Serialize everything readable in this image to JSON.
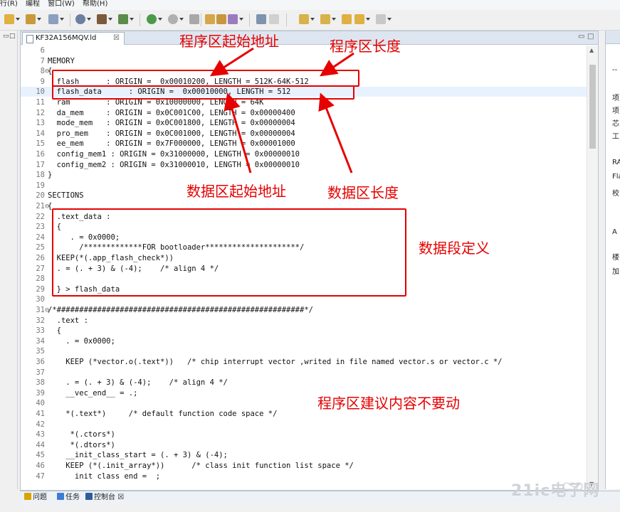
{
  "menubar": {
    "items": [
      "行(R)",
      "编程",
      "窗口(W)",
      "帮助(H)"
    ]
  },
  "toolbar": {
    "buttons": [
      "new-icon",
      "save-icon",
      "copy-icon",
      "build-icon",
      "debug-icon",
      "hammer-icon",
      "tools-icon",
      "bug-icon",
      "run-icon",
      "stop-icon",
      "open-folder-icon",
      "open-file-icon",
      "wand-icon",
      "toggle-icon",
      "pilcrow-icon",
      "next-annotation-icon",
      "prev-annotation-icon",
      "back-icon",
      "forward-icon"
    ]
  },
  "editor": {
    "tab": {
      "label": "KF32A156MQV.ld",
      "close": "☒"
    },
    "tab_controls": {
      "minimize": "▭",
      "maximize": "□"
    },
    "lines": [
      {
        "n": "6",
        "f": "",
        "t": ""
      },
      {
        "n": "7",
        "f": "",
        "t": "MEMORY"
      },
      {
        "n": "8",
        "f": "⊖",
        "t": "{"
      },
      {
        "n": "9",
        "f": "",
        "t": "  flash      : ORIGIN =  0x00010200, LENGTH = 512K-64K-512"
      },
      {
        "n": "10",
        "f": "",
        "t": "  flash_data      : ORIGIN =  0x00010000, LENGTH = 512"
      },
      {
        "n": "11",
        "f": "",
        "t": "  ram        : ORIGIN = 0x10000000, LENGTH = 64K"
      },
      {
        "n": "12",
        "f": "",
        "t": "  da_mem     : ORIGIN = 0x0C001C00, LENGTH = 0x00000400"
      },
      {
        "n": "13",
        "f": "",
        "t": "  mode_mem   : ORIGIN = 0x0C001800, LENGTH = 0x00000004"
      },
      {
        "n": "14",
        "f": "",
        "t": "  pro_mem    : ORIGIN = 0x0C001000, LENGTH = 0x00000004"
      },
      {
        "n": "15",
        "f": "",
        "t": "  ee_mem     : ORIGIN = 0x7F000000, LENGTH = 0x00001000"
      },
      {
        "n": "16",
        "f": "",
        "t": "  config_mem1 : ORIGIN = 0x31000000, LENGTH = 0x00000010"
      },
      {
        "n": "17",
        "f": "",
        "t": "  config_mem2 : ORIGIN = 0x31000010, LENGTH = 0x00000010"
      },
      {
        "n": "18",
        "f": "",
        "t": "}"
      },
      {
        "n": "19",
        "f": "",
        "t": ""
      },
      {
        "n": "20",
        "f": "",
        "t": "SECTIONS"
      },
      {
        "n": "21",
        "f": "⊖",
        "t": "{"
      },
      {
        "n": "22",
        "f": "",
        "t": "  .text_data :"
      },
      {
        "n": "23",
        "f": "",
        "t": "  {"
      },
      {
        "n": "24",
        "f": "",
        "t": "     . = 0x0000;"
      },
      {
        "n": "25",
        "f": "",
        "t": "       /*************FOR bootloader*********************/"
      },
      {
        "n": "26",
        "f": "",
        "t": "  KEEP(*(.app_flash_check*))"
      },
      {
        "n": "27",
        "f": "",
        "t": "  . = (. + 3) & (-4);    /* align 4 */"
      },
      {
        "n": "28",
        "f": "",
        "t": ""
      },
      {
        "n": "29",
        "f": "",
        "t": "  } > flash_data"
      },
      {
        "n": "30",
        "f": "",
        "t": ""
      },
      {
        "n": "31",
        "f": "⊖",
        "t": "/*#######################################################*/"
      },
      {
        "n": "32",
        "f": "",
        "t": "  .text :"
      },
      {
        "n": "33",
        "f": "",
        "t": "  {"
      },
      {
        "n": "34",
        "f": "",
        "t": "    . = 0x0000;"
      },
      {
        "n": "35",
        "f": "",
        "t": ""
      },
      {
        "n": "36",
        "f": "",
        "t": "    KEEP (*vector.o(.text*))   /* chip interrupt vector ,writed in file named vector.s or vector.c */"
      },
      {
        "n": "37",
        "f": "",
        "t": ""
      },
      {
        "n": "38",
        "f": "",
        "t": "    . = (. + 3) & (-4);    /* align 4 */"
      },
      {
        "n": "39",
        "f": "",
        "t": "    __vec_end__ = .;"
      },
      {
        "n": "40",
        "f": "",
        "t": ""
      },
      {
        "n": "41",
        "f": "",
        "t": "    *(.text*)     /* default function code space */"
      },
      {
        "n": "42",
        "f": "",
        "t": ""
      },
      {
        "n": "43",
        "f": "",
        "t": "     *(.ctors*)"
      },
      {
        "n": "44",
        "f": "",
        "t": "     *(.dtors*)"
      },
      {
        "n": "45",
        "f": "",
        "t": "    __init_class_start = (. + 3) & (-4);"
      },
      {
        "n": "46",
        "f": "",
        "t": "    KEEP (*(.init_array*))      /* class init function list space */"
      },
      {
        "n": "47",
        "f": "",
        "t": "      init class end =  ;"
      }
    ]
  },
  "left_pane": {
    "min": "▭",
    "max": "□"
  },
  "right_pane": {
    "lines": [
      "--",
      "项",
      "项",
      "芯",
      "工",
      "RA",
      "Fla",
      "校",
      "A",
      "楼",
      "加"
    ]
  },
  "bottom_tabs": [
    {
      "label": "问题",
      "icon": "problems-icon",
      "color": "#d9a400"
    },
    {
      "label": "任务",
      "icon": "tasks-icon",
      "color": "#3d7bd6"
    },
    {
      "label": "控制台",
      "icon": "console-icon",
      "color": "#2f5d9a",
      "close": "☒"
    }
  ],
  "annotations": {
    "prog_start": "程序区起始地址",
    "prog_len": "程序区长度",
    "data_start": "数据区起始地址",
    "data_len": "数据区长度",
    "data_seg": "数据段定义",
    "prog_note": "程序区建议内容不要动"
  },
  "accent_color": "#e60000",
  "watermark": {
    "main": "21ic电子网",
    "sub": "CSDN"
  }
}
